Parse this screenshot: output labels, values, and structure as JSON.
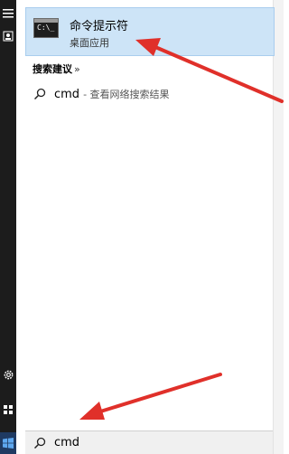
{
  "best_match": {
    "title": "命令提示符",
    "subtitle": "桌面应用",
    "icon": "command-prompt-icon"
  },
  "suggestions_section": {
    "heading": "搜索建议",
    "chevron": "»"
  },
  "suggestions": [
    {
      "term": "cmd",
      "description": "- 查看网络搜索结果",
      "icon": "search-icon"
    }
  ],
  "search": {
    "value": "cmd",
    "icon": "search-icon"
  },
  "rail": {
    "icons": [
      "hamburger-icon",
      "user-icon",
      "settings-icon",
      "power-icon"
    ]
  },
  "taskbar": {
    "start_icon": "windows-logo-icon"
  },
  "colors": {
    "highlight_bg": "#cde4f7",
    "rail_bg": "#1c1c1c",
    "arrow": "#e0302a",
    "start_bg": "#1f3a62"
  }
}
